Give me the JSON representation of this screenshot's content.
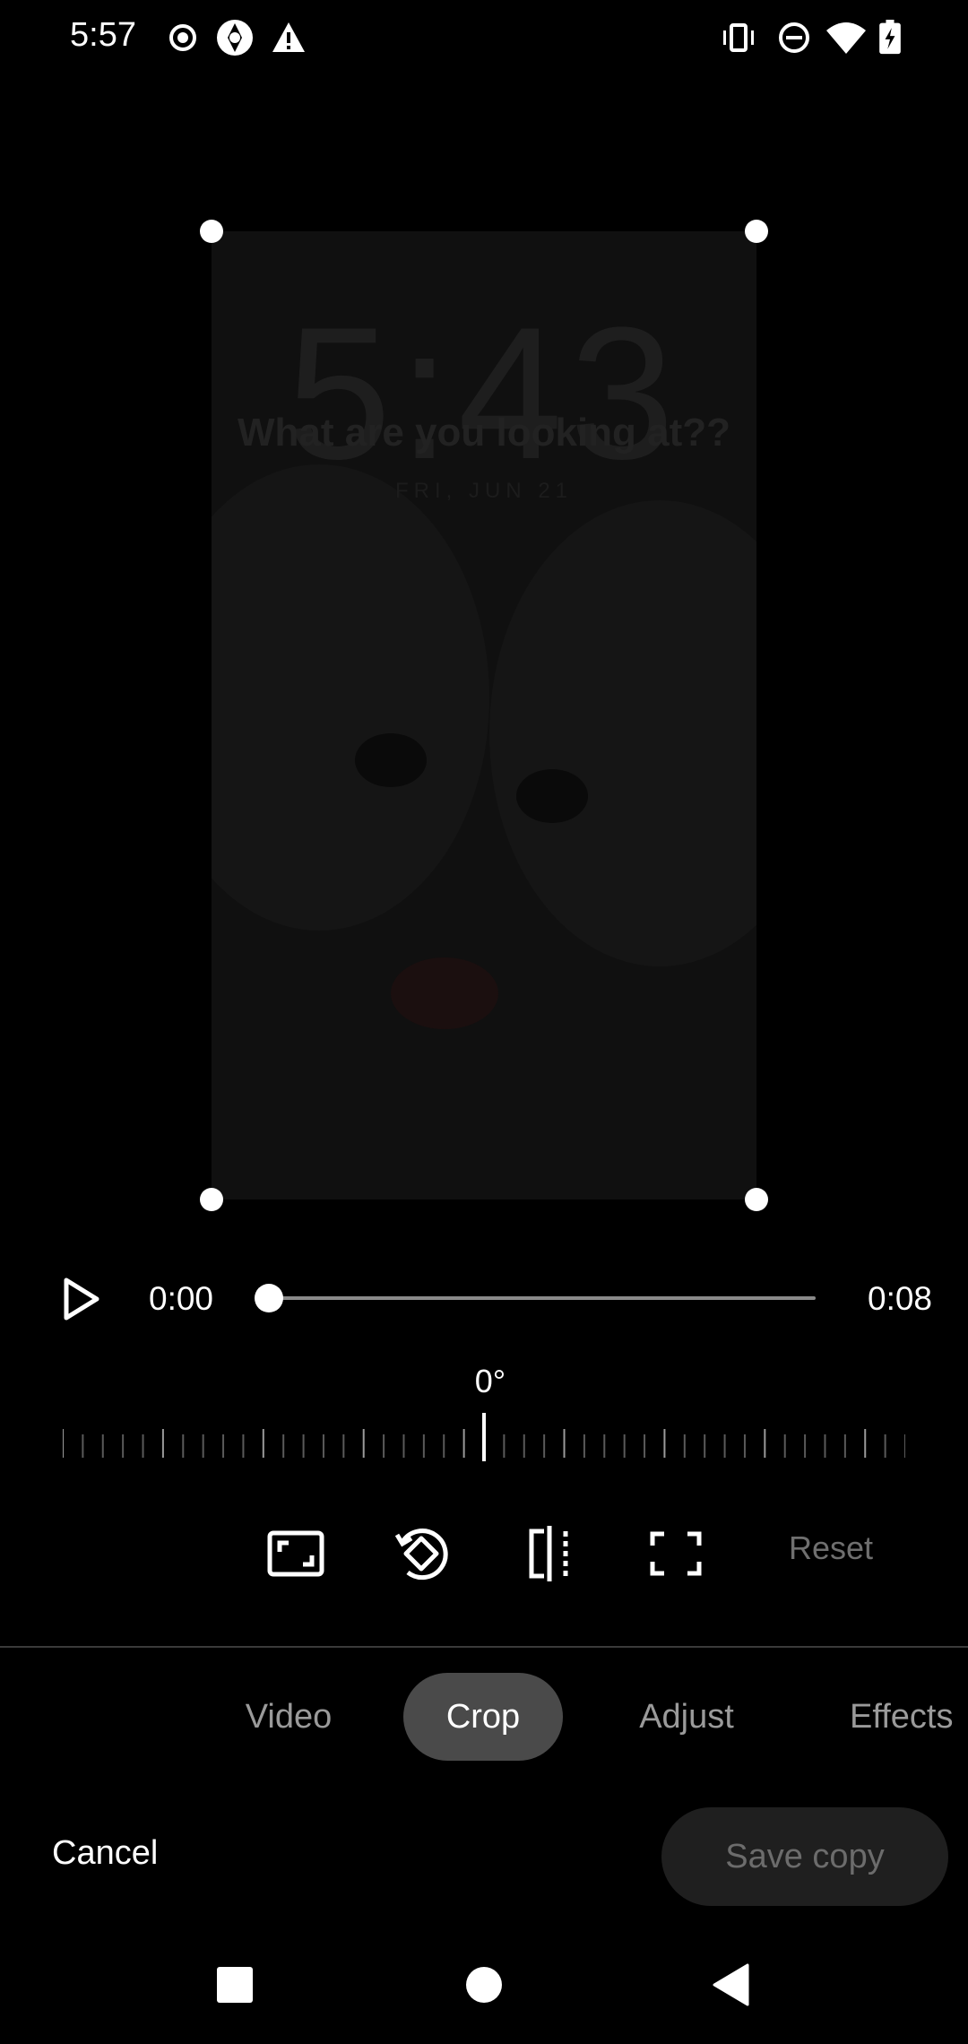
{
  "status_bar": {
    "time": "5:57",
    "left_icons": [
      "record-icon",
      "app-shutter-icon",
      "warning-icon"
    ],
    "right_icons": [
      "vibrate-icon",
      "do-not-disturb-icon",
      "wifi-icon",
      "battery-charging-icon"
    ]
  },
  "preview": {
    "clock_text": "5:43",
    "caption_text": "What are you looking at??",
    "date_text": "FRI, JUN 21"
  },
  "player": {
    "current_time": "0:00",
    "duration": "0:08",
    "progress": 0.0
  },
  "rotation": {
    "angle_label": "0°"
  },
  "tools": {
    "aspect_icon": "aspect-ratio-icon",
    "rotate_icon": "rotate-icon",
    "flip_icon": "flip-icon",
    "free_crop_icon": "free-crop-icon",
    "reset_label": "Reset"
  },
  "tabs": [
    {
      "label": "Video",
      "active": false
    },
    {
      "label": "Crop",
      "active": true
    },
    {
      "label": "Adjust",
      "active": false
    },
    {
      "label": "Effects",
      "active": false
    }
  ],
  "actions": {
    "cancel_label": "Cancel",
    "save_label": "Save copy"
  },
  "colors": {
    "background": "#000000",
    "active_tab": "#4a4a4a",
    "disabled_text": "#6f6f6f"
  }
}
